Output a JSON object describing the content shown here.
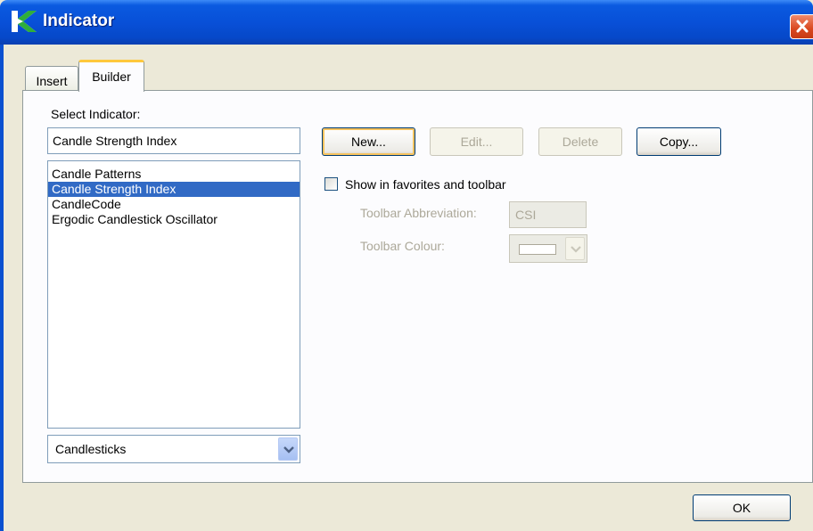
{
  "window": {
    "title": "Indicator",
    "icon": "k-logo-icon"
  },
  "tabs": [
    {
      "label": "Insert",
      "active": false
    },
    {
      "label": "Builder",
      "active": true
    }
  ],
  "builder": {
    "select_label": "Select Indicator:",
    "selected_value": "Candle Strength Index",
    "indicators": [
      "Candle Patterns",
      "Candle Strength Index",
      "CandleCode",
      "Ergodic Candlestick Oscillator"
    ],
    "selected_index": 1,
    "category": "Candlesticks",
    "buttons": {
      "new": "New...",
      "edit": "Edit...",
      "delete": "Delete",
      "copy": "Copy..."
    },
    "show_in_favorites_label": "Show in favorites and toolbar",
    "show_in_favorites_checked": false,
    "toolbar_abbreviation_label": "Toolbar Abbreviation:",
    "toolbar_abbreviation_value": "CSI",
    "toolbar_colour_label": "Toolbar Colour:",
    "toolbar_colour": "#ffffff"
  },
  "footer": {
    "ok_label": "OK"
  },
  "colors": {
    "titlebar": "#0850d8",
    "selection": "#316ac5",
    "close_button": "#d9471f",
    "default_button_ring": "#f7c35f"
  }
}
